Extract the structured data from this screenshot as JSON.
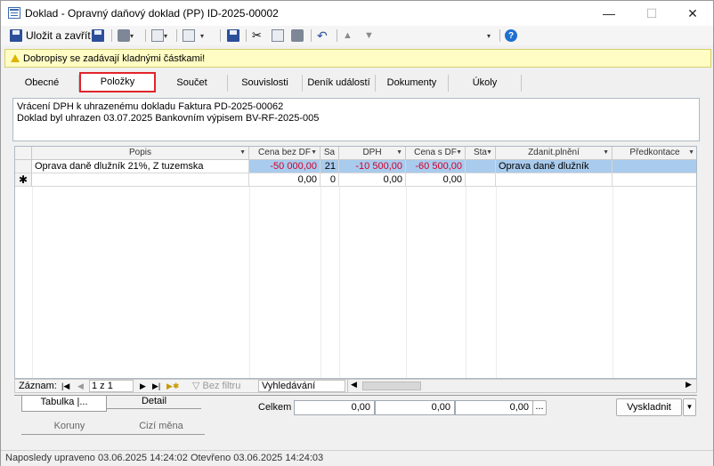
{
  "window": {
    "title": "Doklad - Opravný daňový doklad (PP) ID-2025-00002",
    "minimize": "—",
    "maximize": "☐",
    "close": "✕"
  },
  "toolbar": {
    "save_close_label": "Uložit a zavřít"
  },
  "info": {
    "message": "Dobropisy se zadávají kladnými částkami!"
  },
  "tabs": [
    {
      "label": "Obecné"
    },
    {
      "label": "Položky"
    },
    {
      "label": "Součet"
    },
    {
      "label": "Souvislosti"
    },
    {
      "label": "Deník událostí"
    },
    {
      "label": "Dokumenty"
    },
    {
      "label": "Úkoly"
    }
  ],
  "note": {
    "line1": "Vrácení DPH k uhrazenému dokladu Faktura PD-2025-00062",
    "line2": "Doklad byl uhrazen 03.07.2025 Bankovním výpisem BV-RF-2025-005"
  },
  "grid": {
    "columns": [
      {
        "label": "Popis"
      },
      {
        "label": "Cena bez DF"
      },
      {
        "label": "Sa"
      },
      {
        "label": "DPH"
      },
      {
        "label": "Cena s DF"
      },
      {
        "label": "Sta"
      },
      {
        "label": "Zdanit.plnění"
      },
      {
        "label": "Předkontace"
      }
    ],
    "rows": [
      {
        "popis": "Oprava daně dlužník 21%, Z tuzemska",
        "cena_bez": "-50 000,00",
        "sazba": "21",
        "dph": "-10 500,00",
        "cena_s": "-60 500,00",
        "stat": "",
        "zdanit": "Oprava daně dlužník",
        "predkontace": ""
      }
    ],
    "new_row": {
      "marker": "✱",
      "cena_bez": "0,00",
      "sazba": "0",
      "dph": "0,00",
      "cena_s": "0,00"
    }
  },
  "navigator": {
    "label": "Záznam:",
    "position": "1 z 1",
    "filter": "Bez filtru",
    "search": "Vyhledávání"
  },
  "bottom": {
    "tab_table": "Tabulka",
    "tab_detail": "Detail",
    "tab_currency_local": "Koruny",
    "tab_currency_foreign": "Cizí měna",
    "totals_label": "Celkem",
    "total1": "0,00",
    "total2": "0,00",
    "total3": "0,00",
    "ellipsis": "...",
    "store_button": "Vyskladnit"
  },
  "status": {
    "text": "Naposledy upraveno 03.06.2025 14:24:02 Otevřeno 03.06.2025 14:24:03"
  }
}
